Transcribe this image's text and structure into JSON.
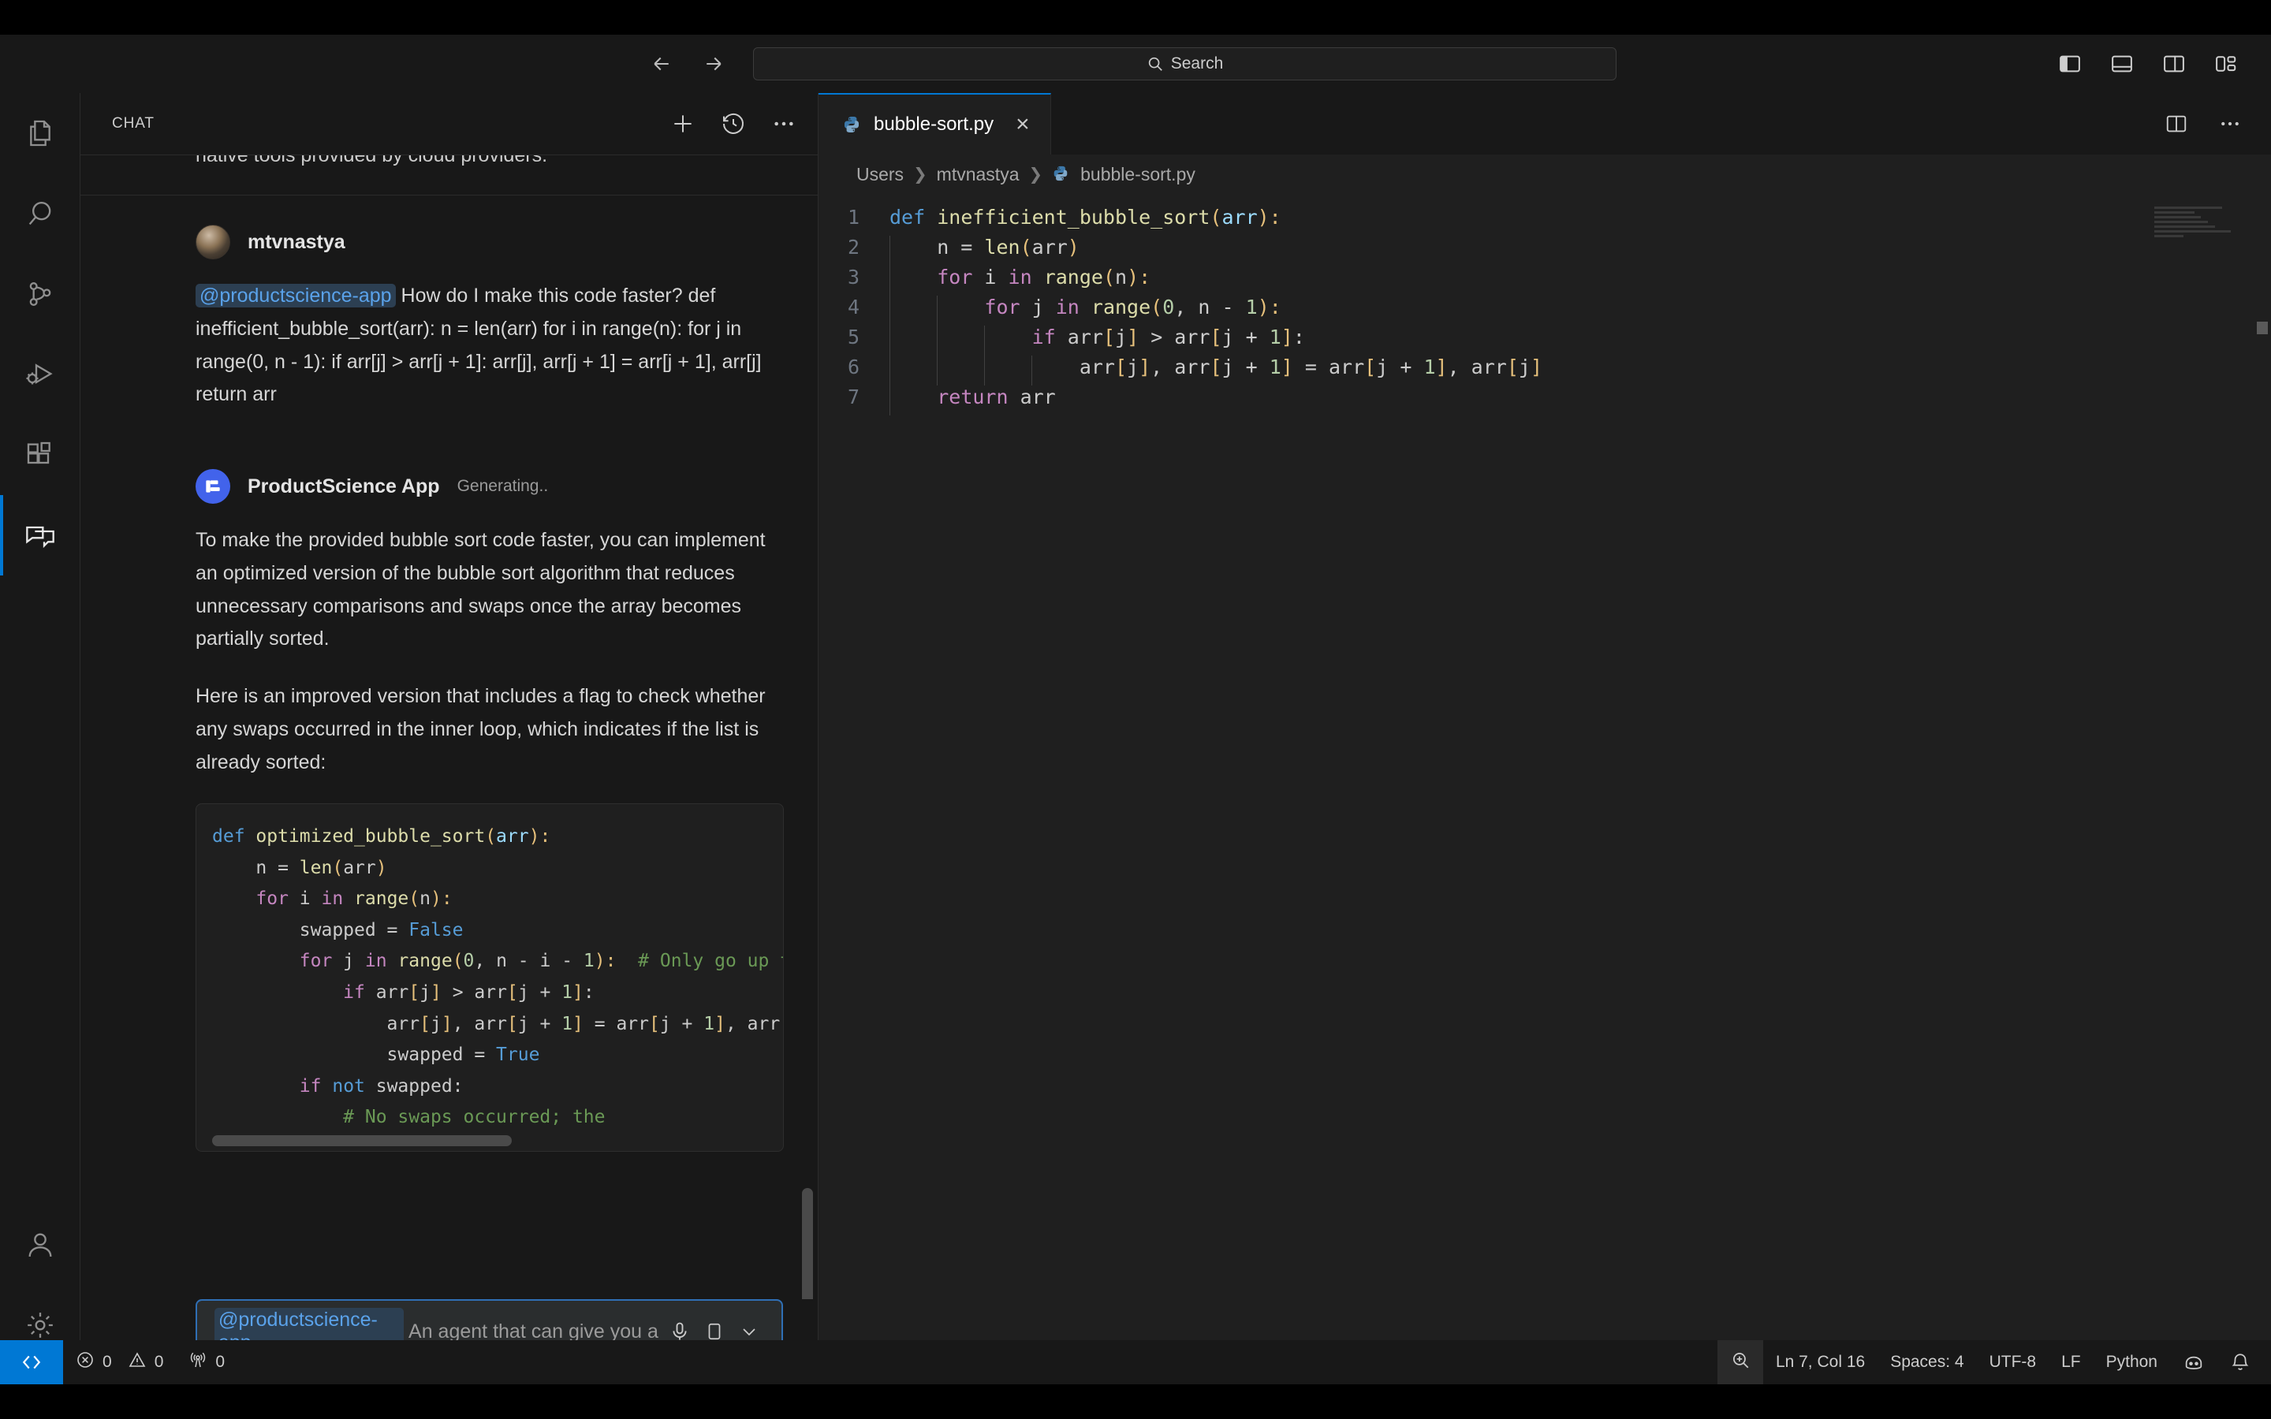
{
  "titlebar": {
    "back_icon": "arrow-left-icon",
    "forward_icon": "arrow-right-icon",
    "search_placeholder": "Search",
    "search_icon": "search-icon",
    "layout_toggles": [
      {
        "name": "toggle-primary-sidebar",
        "label": "Toggle Primary Side Bar"
      },
      {
        "name": "toggle-panel",
        "label": "Toggle Panel"
      },
      {
        "name": "toggle-secondary-sidebar",
        "label": "Toggle Secondary Side Bar"
      },
      {
        "name": "customize-layout",
        "label": "Customize Layout"
      }
    ]
  },
  "activitybar": {
    "items": [
      {
        "name": "explorer",
        "icon": "files-icon",
        "active": false
      },
      {
        "name": "search",
        "icon": "search-icon",
        "active": false
      },
      {
        "name": "source-control",
        "icon": "source-control-icon",
        "active": false
      },
      {
        "name": "run-and-debug",
        "icon": "debug-icon",
        "active": false
      },
      {
        "name": "extensions",
        "icon": "extensions-icon",
        "active": false
      },
      {
        "name": "chat",
        "icon": "chat-icon",
        "active": true
      }
    ],
    "bottom_items": [
      {
        "name": "accounts",
        "icon": "account-icon"
      },
      {
        "name": "manage",
        "icon": "gear-icon"
      }
    ]
  },
  "sidebar": {
    "title": "CHAT",
    "actions": [
      {
        "name": "new-chat",
        "icon": "plus-icon"
      },
      {
        "name": "chat-history",
        "icon": "history-icon"
      },
      {
        "name": "more-actions",
        "icon": "ellipsis-icon"
      }
    ],
    "scrolled_off_text": "native tools provided by cloud providers.",
    "messages": [
      {
        "author": "mtvnastya",
        "role": "user",
        "status": "",
        "avatar": "user-avatar",
        "mention": "@productscience-app",
        "text": " How do I make this code faster? def inefficient_bubble_sort(arr): n = len(arr) for i in range(n): for j in range(0, n - 1): if arr[j] > arr[j + 1]: arr[j], arr[j + 1] = arr[j + 1], arr[j] return arr"
      },
      {
        "author": "ProductScience App",
        "role": "assistant",
        "status": "Generating..",
        "avatar": "app-avatar",
        "paragraphs": [
          "To make the provided bubble sort code faster, you can implement an optimized version of the bubble sort algorithm that reduces unnecessary comparisons and swaps once the array becomes partially sorted.",
          "Here is an improved version that includes a flag to check whether any swaps occurred in the inner loop, which indicates if the list is already sorted:"
        ]
      }
    ],
    "code_block": {
      "language": "python",
      "lines": [
        [
          {
            "t": "def ",
            "c": "k"
          },
          {
            "t": "optimized_bubble_sort",
            "c": "fn"
          },
          {
            "t": "(",
            "c": "par"
          },
          {
            "t": "arr",
            "c": "v"
          },
          {
            "t": "):",
            "c": "par"
          }
        ],
        [
          {
            "t": "    n = ",
            "c": "d"
          },
          {
            "t": "len",
            "c": "fn"
          },
          {
            "t": "(",
            "c": "par"
          },
          {
            "t": "arr",
            "c": "d"
          },
          {
            "t": ")",
            "c": "par"
          }
        ],
        [
          {
            "t": "    ",
            "c": "d"
          },
          {
            "t": "for",
            "c": "p"
          },
          {
            "t": " i ",
            "c": "d"
          },
          {
            "t": "in",
            "c": "p"
          },
          {
            "t": " ",
            "c": "d"
          },
          {
            "t": "range",
            "c": "fn"
          },
          {
            "t": "(",
            "c": "par"
          },
          {
            "t": "n",
            "c": "d"
          },
          {
            "t": "):",
            "c": "par"
          }
        ],
        [
          {
            "t": "        swapped = ",
            "c": "d"
          },
          {
            "t": "False",
            "c": "t"
          }
        ],
        [
          {
            "t": "        ",
            "c": "d"
          },
          {
            "t": "for",
            "c": "p"
          },
          {
            "t": " j ",
            "c": "d"
          },
          {
            "t": "in",
            "c": "p"
          },
          {
            "t": " ",
            "c": "d"
          },
          {
            "t": "range",
            "c": "fn"
          },
          {
            "t": "(",
            "c": "par"
          },
          {
            "t": "0",
            "c": "n"
          },
          {
            "t": ", n ",
            "c": "d"
          },
          {
            "t": "-",
            "c": "d"
          },
          {
            "t": " i ",
            "c": "d"
          },
          {
            "t": "-",
            "c": "d"
          },
          {
            "t": " ",
            "c": "d"
          },
          {
            "t": "1",
            "c": "n"
          },
          {
            "t": "):",
            "c": "par"
          },
          {
            "t": "  # Only go up t",
            "c": "c"
          }
        ],
        [
          {
            "t": "            ",
            "c": "d"
          },
          {
            "t": "if",
            "c": "p"
          },
          {
            "t": " arr",
            "c": "d"
          },
          {
            "t": "[",
            "c": "par"
          },
          {
            "t": "j",
            "c": "d"
          },
          {
            "t": "]",
            "c": "par"
          },
          {
            "t": " > arr",
            "c": "d"
          },
          {
            "t": "[",
            "c": "par"
          },
          {
            "t": "j + ",
            "c": "d"
          },
          {
            "t": "1",
            "c": "n"
          },
          {
            "t": "]",
            "c": "par"
          },
          {
            "t": ":",
            "c": "d"
          }
        ],
        [
          {
            "t": "                arr",
            "c": "d"
          },
          {
            "t": "[",
            "c": "par"
          },
          {
            "t": "j",
            "c": "d"
          },
          {
            "t": "]",
            "c": "par"
          },
          {
            "t": ", arr",
            "c": "d"
          },
          {
            "t": "[",
            "c": "par"
          },
          {
            "t": "j + ",
            "c": "d"
          },
          {
            "t": "1",
            "c": "n"
          },
          {
            "t": "]",
            "c": "par"
          },
          {
            "t": " = arr",
            "c": "d"
          },
          {
            "t": "[",
            "c": "par"
          },
          {
            "t": "j + ",
            "c": "d"
          },
          {
            "t": "1",
            "c": "n"
          },
          {
            "t": "]",
            "c": "par"
          },
          {
            "t": ", arr",
            "c": "d"
          },
          {
            "t": "[",
            "c": "par"
          }
        ],
        [
          {
            "t": "                swapped = ",
            "c": "d"
          },
          {
            "t": "True",
            "c": "t"
          }
        ],
        [
          {
            "t": "        ",
            "c": "d"
          },
          {
            "t": "if",
            "c": "p"
          },
          {
            "t": " ",
            "c": "d"
          },
          {
            "t": "not",
            "c": "t"
          },
          {
            "t": " swapped:",
            "c": "d"
          }
        ],
        [
          {
            "t": "            ",
            "c": "d"
          },
          {
            "t": "# No swaps occurred; the",
            "c": "c"
          }
        ]
      ]
    },
    "input": {
      "mention": "@productscience-app",
      "placeholder": "An agent that can give you a p",
      "mic_icon": "microphone-icon",
      "model_icon": "model-picker-icon",
      "chevron_icon": "chevron-down-icon"
    }
  },
  "editor": {
    "tab": {
      "label": "bubble-sort.py",
      "icon": "python-file-icon",
      "close_icon": "close-icon"
    },
    "tab_actions": [
      {
        "name": "split-editor",
        "icon": "split-editor-icon"
      },
      {
        "name": "more-actions",
        "icon": "ellipsis-icon"
      }
    ],
    "breadcrumb": [
      "Users",
      "mtvnastya",
      "bubble-sort.py"
    ],
    "code": {
      "lines": [
        {
          "n": 1,
          "parts": [
            {
              "t": "def ",
              "c": "k"
            },
            {
              "t": "inefficient_bubble_sort",
              "c": "fn"
            },
            {
              "t": "(",
              "c": "par"
            },
            {
              "t": "arr",
              "c": "v"
            },
            {
              "t": "):",
              "c": "par"
            }
          ],
          "guides": 0
        },
        {
          "n": 2,
          "parts": [
            {
              "t": "    n = ",
              "c": "d"
            },
            {
              "t": "len",
              "c": "fn"
            },
            {
              "t": "(",
              "c": "par"
            },
            {
              "t": "arr",
              "c": "d"
            },
            {
              "t": ")",
              "c": "par"
            }
          ],
          "guides": 1
        },
        {
          "n": 3,
          "parts": [
            {
              "t": "    ",
              "c": "d"
            },
            {
              "t": "for",
              "c": "p"
            },
            {
              "t": " i ",
              "c": "d"
            },
            {
              "t": "in",
              "c": "p"
            },
            {
              "t": " ",
              "c": "d"
            },
            {
              "t": "range",
              "c": "fn"
            },
            {
              "t": "(",
              "c": "par"
            },
            {
              "t": "n",
              "c": "d"
            },
            {
              "t": "):",
              "c": "par"
            }
          ],
          "guides": 1
        },
        {
          "n": 4,
          "parts": [
            {
              "t": "        ",
              "c": "d"
            },
            {
              "t": "for",
              "c": "p"
            },
            {
              "t": " j ",
              "c": "d"
            },
            {
              "t": "in",
              "c": "p"
            },
            {
              "t": " ",
              "c": "d"
            },
            {
              "t": "range",
              "c": "fn"
            },
            {
              "t": "(",
              "c": "par"
            },
            {
              "t": "0",
              "c": "n"
            },
            {
              "t": ", n ",
              "c": "d"
            },
            {
              "t": "-",
              "c": "d"
            },
            {
              "t": " ",
              "c": "d"
            },
            {
              "t": "1",
              "c": "n"
            },
            {
              "t": "):",
              "c": "par"
            }
          ],
          "guides": 2
        },
        {
          "n": 5,
          "parts": [
            {
              "t": "            ",
              "c": "d"
            },
            {
              "t": "if",
              "c": "p"
            },
            {
              "t": " arr",
              "c": "d"
            },
            {
              "t": "[",
              "c": "par"
            },
            {
              "t": "j",
              "c": "d"
            },
            {
              "t": "]",
              "c": "par"
            },
            {
              "t": " > arr",
              "c": "d"
            },
            {
              "t": "[",
              "c": "par"
            },
            {
              "t": "j + ",
              "c": "d"
            },
            {
              "t": "1",
              "c": "n"
            },
            {
              "t": "]",
              "c": "par"
            },
            {
              "t": ":",
              "c": "d"
            }
          ],
          "guides": 3
        },
        {
          "n": 6,
          "parts": [
            {
              "t": "                arr",
              "c": "d"
            },
            {
              "t": "[",
              "c": "par"
            },
            {
              "t": "j",
              "c": "d"
            },
            {
              "t": "]",
              "c": "par"
            },
            {
              "t": ", arr",
              "c": "d"
            },
            {
              "t": "[",
              "c": "par"
            },
            {
              "t": "j + ",
              "c": "d"
            },
            {
              "t": "1",
              "c": "n"
            },
            {
              "t": "]",
              "c": "par"
            },
            {
              "t": " = arr",
              "c": "d"
            },
            {
              "t": "[",
              "c": "par"
            },
            {
              "t": "j + ",
              "c": "d"
            },
            {
              "t": "1",
              "c": "n"
            },
            {
              "t": "]",
              "c": "par"
            },
            {
              "t": ", arr",
              "c": "d"
            },
            {
              "t": "[",
              "c": "par"
            },
            {
              "t": "j",
              "c": "d"
            },
            {
              "t": "]",
              "c": "par"
            }
          ],
          "guides": 4
        },
        {
          "n": 7,
          "parts": [
            {
              "t": "    ",
              "c": "d"
            },
            {
              "t": "return",
              "c": "p"
            },
            {
              "t": " arr",
              "c": "d"
            }
          ],
          "guides": 1
        }
      ]
    }
  },
  "statusbar": {
    "remote_icon": "remote-window-icon",
    "problems": {
      "errors_icon": "error-icon",
      "errors": "0",
      "warnings_icon": "warning-icon",
      "warnings": "0"
    },
    "ports": {
      "icon": "radio-tower-icon",
      "count": "0"
    },
    "right_items": [
      {
        "name": "zoom-indicator",
        "icon": "zoom-icon",
        "label": ""
      },
      {
        "name": "editor-position",
        "label": "Ln 7, Col 16"
      },
      {
        "name": "editor-indentation",
        "label": "Spaces: 4"
      },
      {
        "name": "editor-encoding",
        "label": "UTF-8"
      },
      {
        "name": "editor-eol",
        "label": "LF"
      },
      {
        "name": "editor-language",
        "label": "Python"
      },
      {
        "name": "copilot-status",
        "icon": "copilot-icon",
        "label": ""
      },
      {
        "name": "notifications",
        "icon": "bell-icon",
        "label": ""
      }
    ]
  }
}
